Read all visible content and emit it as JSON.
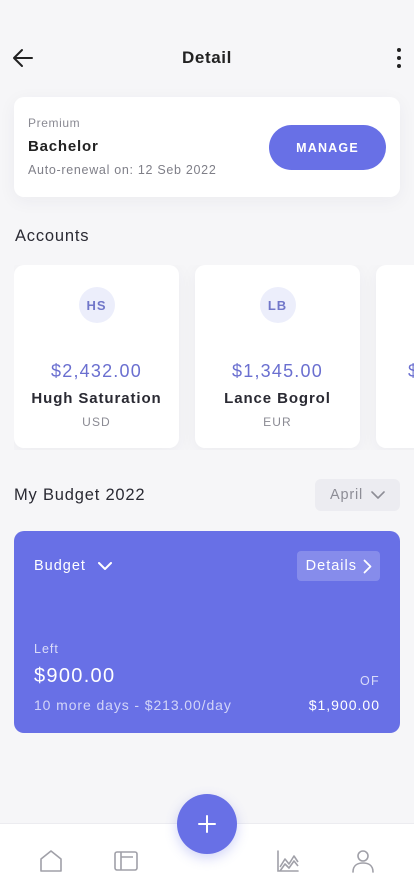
{
  "header": {
    "title": "Detail",
    "back_icon": "arrow-left-icon",
    "more_icon": "more-vertical-icon"
  },
  "subscription": {
    "tier": "Premium",
    "plan": "Bachelor",
    "renewal": "Auto-renewal on: 12 Seb 2022",
    "manage_label": "MANAGE"
  },
  "accounts": {
    "title": "Accounts",
    "items": [
      {
        "initials": "HS",
        "amount": "$2,432.00",
        "name": "Hugh Saturation",
        "currency": "USD"
      },
      {
        "initials": "LB",
        "amount": "$1,345.00",
        "name": "Lance Bogrol",
        "currency": "EUR"
      },
      {
        "initials": "",
        "amount": "$",
        "name": "",
        "currency": ""
      }
    ]
  },
  "budget": {
    "title": "My Budget 2022",
    "month": "April",
    "dropdown_label": "Budget",
    "details_label": "Details",
    "left_label": "Left",
    "left_amount": "$900.00",
    "rate": "10 more days - $213.00/day",
    "of_label": "OF",
    "total": "$1,900.00"
  },
  "nav": {
    "items": [
      "home-icon",
      "wallet-icon",
      "add-icon",
      "chart-icon",
      "profile-icon"
    ]
  },
  "colors": {
    "accent": "#6870e6",
    "background": "#f6f6f8",
    "card": "#ffffff"
  }
}
